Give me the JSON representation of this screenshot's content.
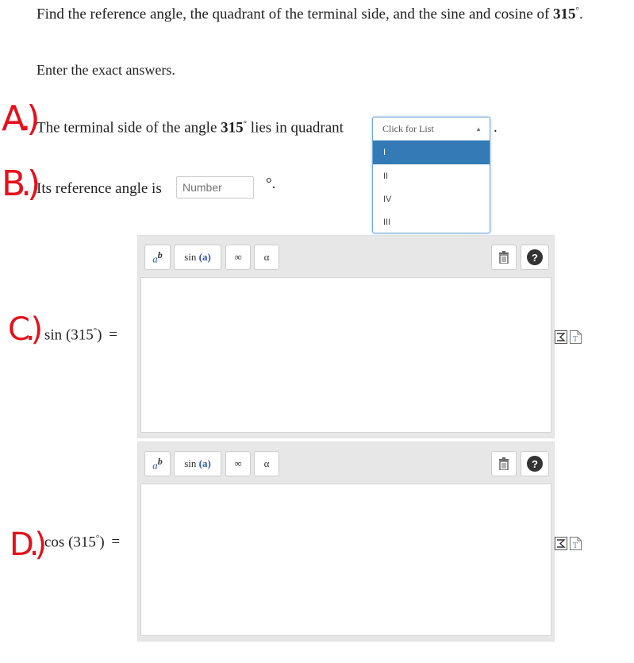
{
  "question": {
    "prompt_text": "Find the reference angle, the quadrant of the terminal side, and the sine and cosine of",
    "angle": "315",
    "degree": "°",
    "end_punct": ".",
    "instruction": "Enter the exact answers."
  },
  "part_a": {
    "marker": "A.)",
    "text": "The terminal side of the angle",
    "angle": "315",
    "degree": "°",
    "text_after": "lies in quadrant",
    "end_punct": ".",
    "dropdown": {
      "placeholder": "Click for List",
      "options": [
        "I",
        "II",
        "IV",
        "III"
      ],
      "highlighted": "I"
    }
  },
  "part_b": {
    "marker": "B.)",
    "text": "Its reference angle is",
    "input_placeholder": "Number",
    "after": "°."
  },
  "part_c": {
    "marker": "C.)",
    "func": "sin",
    "arg": "(315",
    "arg_end": ")",
    "degree": "°",
    "equals": "="
  },
  "part_d": {
    "marker": "D.)",
    "func": "cos",
    "arg": "(315",
    "arg_end": ")",
    "degree": "°",
    "equals": "="
  },
  "toolbar": {
    "superscript_base": "a",
    "superscript_exp": "b",
    "sin_label": "sin",
    "sin_arg": "(a)",
    "infinity": "∞",
    "alpha": "α",
    "help": "?"
  },
  "icons": [
    "superscript-icon",
    "infinity-icon",
    "alpha-icon",
    "trash-icon",
    "help-icon",
    "equation-editor-icon",
    "text-document-icon",
    "caret-up-icon"
  ]
}
